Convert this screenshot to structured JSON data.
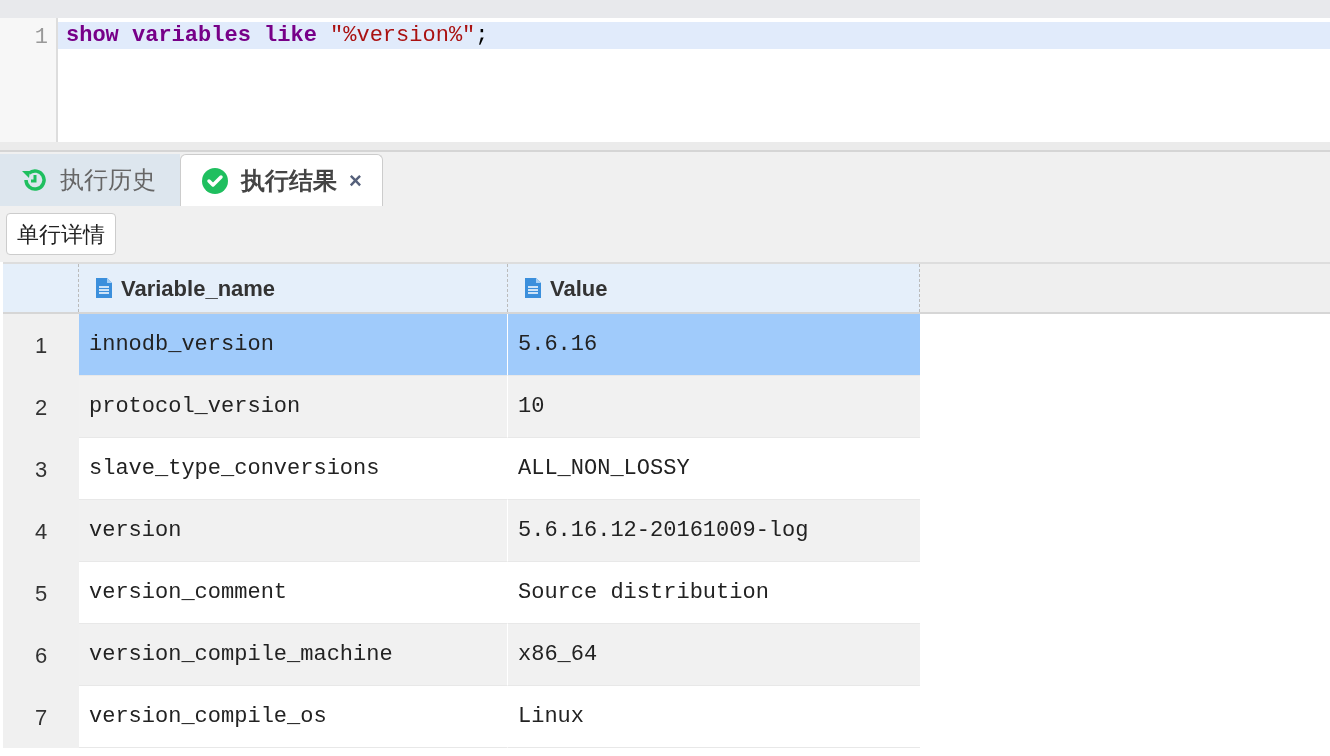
{
  "editor": {
    "lines": [
      {
        "number": "1",
        "current": true,
        "tokens": [
          {
            "kind": "keyword",
            "text": "show"
          },
          {
            "kind": "keyword",
            "text": "variables"
          },
          {
            "kind": "keyword",
            "text": "like"
          },
          {
            "kind": "string",
            "text": "\"%version%\""
          },
          {
            "kind": "punct",
            "text": ";"
          }
        ]
      }
    ]
  },
  "tabs": [
    {
      "label": "执行历史",
      "kind": "history",
      "selected": false
    },
    {
      "label": "执行结果",
      "kind": "result",
      "selected": true,
      "close": "×"
    }
  ],
  "toolbar": {
    "buttons": [
      "单行详情"
    ]
  },
  "table": {
    "columns": [
      "Variable_name",
      "Value"
    ],
    "rows": [
      {
        "number": "1",
        "selected": true,
        "cells": [
          "innodb_version",
          "5.6.16"
        ]
      },
      {
        "number": "2",
        "selected": false,
        "cells": [
          "protocol_version",
          "10"
        ]
      },
      {
        "number": "3",
        "selected": false,
        "cells": [
          "slave_type_conversions",
          "ALL_NON_LOSSY"
        ]
      },
      {
        "number": "4",
        "selected": false,
        "cells": [
          "version",
          "5.6.16.12-20161009-log"
        ]
      },
      {
        "number": "5",
        "selected": false,
        "cells": [
          "version_comment",
          "Source distribution"
        ]
      },
      {
        "number": "6",
        "selected": false,
        "cells": [
          "version_compile_machine",
          "x86_64"
        ]
      },
      {
        "number": "7",
        "selected": false,
        "cells": [
          "version_compile_os",
          "Linux"
        ]
      }
    ]
  }
}
